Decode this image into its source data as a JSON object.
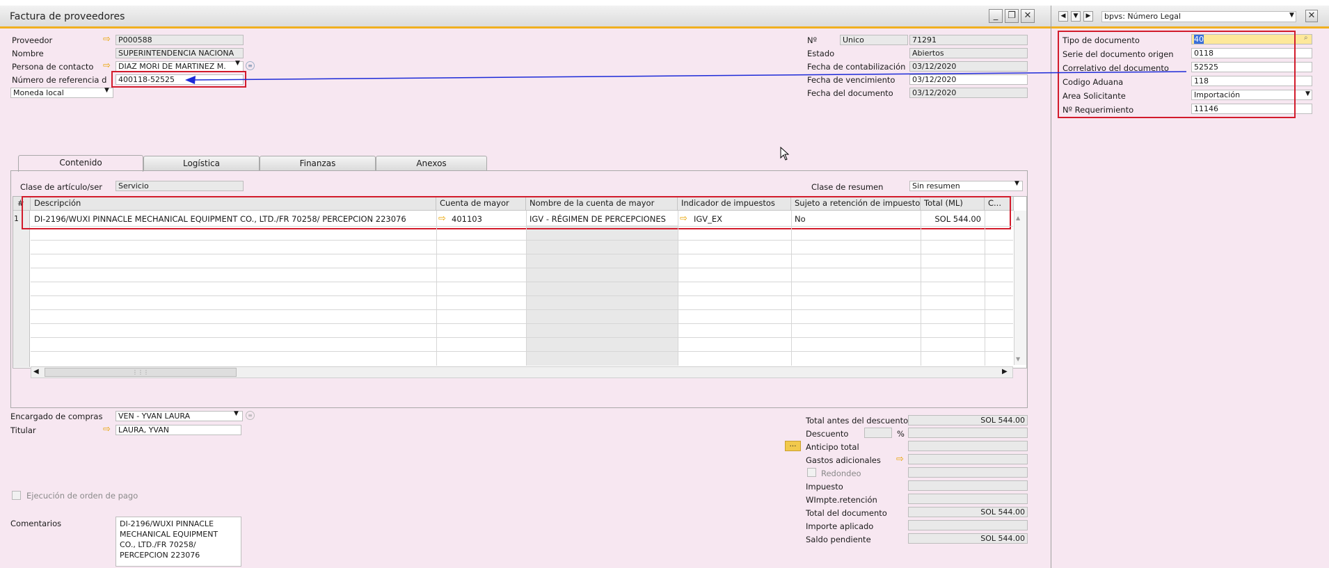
{
  "window": {
    "title": "Factura de proveedores"
  },
  "header_left": {
    "proveedor_label": "Proveedor",
    "proveedor_value": "P000588",
    "nombre_label": "Nombre",
    "nombre_value": "SUPERINTENDENCIA NACIONA",
    "contacto_label": "Persona de contacto",
    "contacto_value": "DIAZ MORI DE MARTINEZ M.",
    "referencia_label": "Número de referencia d",
    "referencia_value": "400118-52525",
    "moneda_value": "Moneda local"
  },
  "header_right": {
    "numero_label": "Nº",
    "serie_value": "Unico",
    "numero_value": "71291",
    "estado_label": "Estado",
    "estado_value": "Abiertos",
    "fecha_cont_label": "Fecha de contabilización",
    "fecha_cont_value": "03/12/2020",
    "fecha_venc_label": "Fecha de vencimiento",
    "fecha_venc_value": "03/12/2020",
    "fecha_doc_label": "Fecha del documento",
    "fecha_doc_value": "03/12/2020"
  },
  "tabs": [
    {
      "label": "Contenido"
    },
    {
      "label": "Logística"
    },
    {
      "label": "Finanzas"
    },
    {
      "label": "Anexos"
    }
  ],
  "contenido": {
    "clase_label": "Clase de artículo/ser",
    "clase_value": "Servicio",
    "resumen_label": "Clase de resumen",
    "resumen_value": "Sin resumen"
  },
  "grid": {
    "headers": {
      "num": "#",
      "descripcion": "Descripción",
      "cuenta": "Cuenta de mayor",
      "nombre_cuenta": "Nombre de la cuenta de mayor",
      "indicador": "Indicador de impuestos",
      "sujeto": "Sujeto a retención de impuesto",
      "total": "Total (ML)",
      "extra": "C..."
    },
    "row": {
      "num": "1",
      "descripcion": "DI-2196/WUXI PINNACLE MECHANICAL EQUIPMENT CO., LTD./FR 70258/ PERCEPCION 223076",
      "cuenta": "401103",
      "nombre_cuenta": "IGV - RÉGIMEN DE PERCEPCIONES",
      "indicador": "IGV_EX",
      "sujeto": "No",
      "total": "SOL 544.00"
    }
  },
  "footer_left": {
    "encargado_label": "Encargado de compras",
    "encargado_value": "VEN - YVAN LAURA",
    "titular_label": "Titular",
    "titular_value": "LAURA, YVAN",
    "ejecucion_label": "Ejecución de orden de pago",
    "comentarios_label": "Comentarios",
    "comentarios_lines": [
      "DI-2196/WUXI PINNACLE",
      "MECHANICAL EQUIPMENT",
      "CO., LTD./FR 70258/",
      "PERCEPCION 223076"
    ]
  },
  "totals": {
    "antes_label": "Total antes del descuento",
    "antes_value": "SOL 544.00",
    "descuento_label": "Descuento",
    "pct_label": "%",
    "anticipo_label": "Anticipo total",
    "gastos_label": "Gastos adicionales",
    "redondeo_label": "Redondeo",
    "impuesto_label": "Impuesto",
    "wimpte_label": "WImpte.retención",
    "total_doc_label": "Total del documento",
    "total_doc_value": "SOL 544.00",
    "importe_label": "Importe aplicado",
    "saldo_label": "Saldo pendiente",
    "saldo_value": "SOL 544.00"
  },
  "side_panel": {
    "dropdown_value": "bpvs: Número Legal",
    "fields": [
      {
        "label": "Tipo de documento",
        "value": "40"
      },
      {
        "label": "Serie del documento origen",
        "value": "0118"
      },
      {
        "label": "Correlativo del documento",
        "value": "52525"
      },
      {
        "label": "Codigo Aduana",
        "value": "118"
      },
      {
        "label": "Area Solicitante",
        "value": "Importación"
      },
      {
        "label": "Nº Requerimiento",
        "value": "11146"
      }
    ]
  }
}
